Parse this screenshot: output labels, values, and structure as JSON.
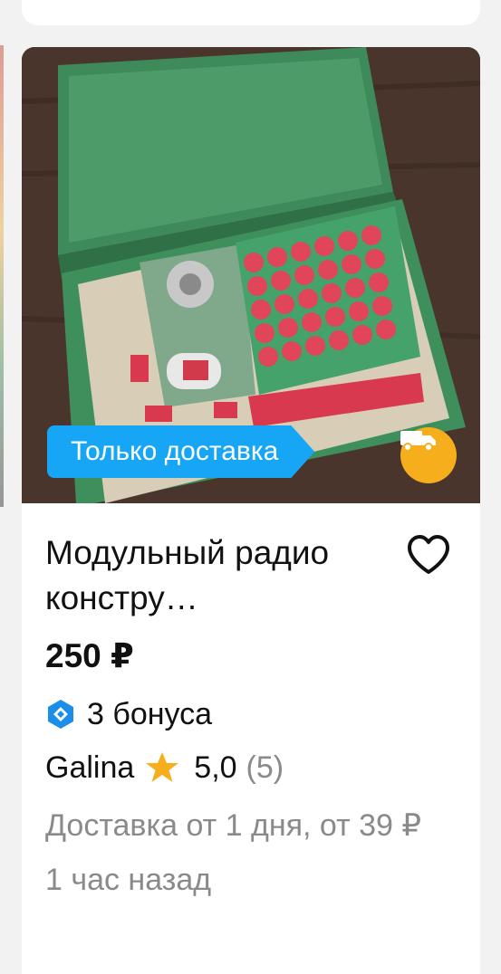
{
  "listing": {
    "chip_label": "Только доставка",
    "title": "Модульный радио констру…",
    "price": "250 ₽",
    "bonus": "3 бонуса",
    "seller": {
      "name": "Galina",
      "rating": "5,0",
      "reviews": "(5)"
    },
    "delivery": "Доставка от 1 дня, от 39 ₽",
    "posted": "1 час назад"
  },
  "colors": {
    "chip": "#16a6f5",
    "truck_badge": "#f6ae1c",
    "star": "#f6ae1c",
    "bonus_icon": "#1a8ee8"
  },
  "icons": [
    "truck-icon",
    "heart-icon",
    "bonus-icon",
    "star-icon"
  ]
}
